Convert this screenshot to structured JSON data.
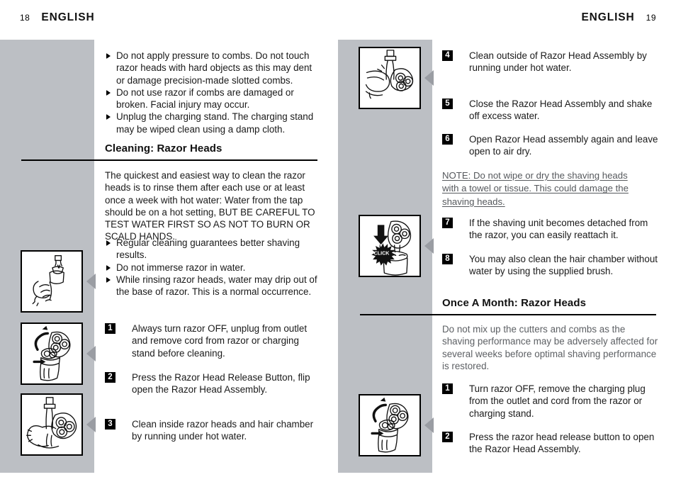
{
  "spread": {
    "left_page": {
      "folio": "18",
      "running_head": "ENGLISH"
    },
    "right_page": {
      "folio": "19",
      "running_head": "ENGLISH"
    }
  },
  "left_column": {
    "warning_bullets": [
      "Do not apply pressure to combs.  Do not touch razor heads with hard objects as this may dent or damage precision-made slotted combs.",
      "Do not use razor if combs are damaged or broken.  Facial injury may occur.",
      "Unplug the charging stand. The charging stand may be wiped clean using a damp cloth."
    ],
    "section_heading": "Cleaning: Razor Heads",
    "intro_paragraph": "The quickest and easiest way to clean the razor heads is to rinse them after each use or at least once a week with hot water: Water from the tap should be on a hot setting, BUT BE CAREFUL TO TEST WATER FIRST SO AS NOT TO BURN OR SCALD HANDS.",
    "tips_bullets": [
      "Regular cleaning guarantees better shaving results.",
      "Do not immerse razor in water.",
      "While rinsing razor heads, water may drip out of the base of razor. This is a normal occurrence."
    ],
    "steps": [
      {
        "number": "1",
        "text": "Always turn razor OFF, unplug from outlet and remove cord from razor or charging stand before cleaning."
      },
      {
        "number": "2",
        "text": "Press the Razor Head Release Button, flip open the Razor Head Assembly."
      },
      {
        "number": "3",
        "text": "Clean inside razor heads and hair chamber by running under hot water."
      }
    ],
    "figures": [
      {
        "name": "figure-hand-holding-razor-under-tap",
        "caption_click": ""
      },
      {
        "name": "figure-flip-open-razor-head",
        "caption_click": ""
      },
      {
        "name": "figure-rinse-inside-razor-heads",
        "caption_click": ""
      }
    ]
  },
  "right_column": {
    "steps_cleaning": [
      {
        "number": "4",
        "text": "Clean outside of Razor Head Assembly by running under hot water."
      },
      {
        "number": "5",
        "text": "Close the Razor Head Assembly and shake off excess water."
      },
      {
        "number": "6",
        "text": "Open Razor Head assembly again and leave open to air dry."
      }
    ],
    "note": "NOTE: Do not wipe or dry the shaving heads with a towel or tissue. This could damage the shaving heads.",
    "steps_reattach": [
      {
        "number": "7",
        "text": "If the shaving unit becomes detached from the razor, you can easily reattach it."
      },
      {
        "number": "8",
        "text": "You may also clean the hair chamber without water by using the supplied brush."
      }
    ],
    "section_heading": "Once A Month: Razor Heads",
    "intro_paragraph": "Do not mix up the cutters and combs as the shaving performance may be adversely affected for several weeks before optimal shaving performance is restored.",
    "steps_month": [
      {
        "number": "1",
        "text": "Turn razor OFF, remove the charging plug from the outlet and cord from the razor or charging stand."
      },
      {
        "number": "2",
        "text": "Press the razor head release button to open the Razor Head Assembly."
      }
    ],
    "figures": [
      {
        "name": "figure-rinse-outside-razor-head",
        "caption_click": ""
      },
      {
        "name": "figure-click-reattach-shaving-unit",
        "caption_click": "CLICK"
      },
      {
        "name": "figure-open-razor-head-assembly",
        "caption_click": ""
      }
    ]
  },
  "colors": {
    "gray_column": "#bcbfc4",
    "arrow_gray": "#9a9da3",
    "text": "#1a1a1a",
    "note_text": "#55585c",
    "rule": "#000000"
  }
}
